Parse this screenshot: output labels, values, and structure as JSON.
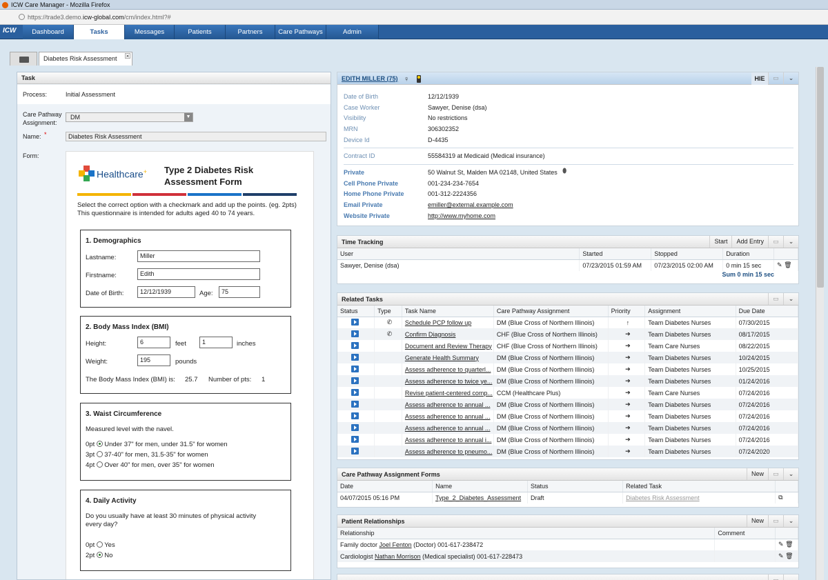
{
  "window": {
    "title": "ICW Care Manager - Mozilla Firefox",
    "url_prefix": "https://trade3.demo.",
    "url_host": "icw-global.com",
    "url_path": "/cm/index.html?#"
  },
  "nav": {
    "logo": "ICW",
    "tabs": [
      "Dashboard",
      "Tasks",
      "Messages",
      "Patients",
      "Partners",
      "Care Pathways",
      "Admin"
    ],
    "active": "Tasks"
  },
  "doc_tab": {
    "label": "Diabetes Risk Assessment",
    "close": "×"
  },
  "task": {
    "header": "Task",
    "process_label": "Process:",
    "process_value": "Initial Assessment",
    "cpa_label": "Care Pathway Assignment:",
    "cpa_value": "DM",
    "name_label": "Name:",
    "name_required": "*",
    "name_value": "Diabetes Risk Assessment",
    "form_label": "Form:"
  },
  "form": {
    "brand": "Healthcare",
    "brand_plus": "+",
    "title": "Type 2 Diabetes Risk Assessment Form",
    "intro": "Select the correct option with a checkmark and add up the points. (eg. 2pts) This questionnaire is intended for adults aged 40 to 74 years.",
    "demographics": {
      "title": "1. Demographics",
      "lastname_label": "Lastname:",
      "lastname": "Miller",
      "firstname_label": "Firstname:",
      "firstname": "Edith",
      "dob_label": "Date of Birth:",
      "dob": "12/12/1939",
      "age_label": "Age:",
      "age": "75"
    },
    "bmi": {
      "title": "2. Body Mass Index (BMI)",
      "height_label": "Height:",
      "height_feet": "6",
      "feet_label": "feet",
      "height_inches": "1",
      "inches_label": "inches",
      "weight_label": "Weight:",
      "weight": "195",
      "pounds_label": "pounds",
      "bmi_label": "The Body Mass Index (BMI) is:",
      "bmi_value": "25.7",
      "points_label": "Number of pts:",
      "points_value": "1"
    },
    "waist": {
      "title": "3. Waist Circumference",
      "desc": "Measured level with the navel.",
      "options": [
        {
          "pts": "0pt",
          "text": "Under 37\" for men, under 31.5\" for women",
          "checked": true
        },
        {
          "pts": "3pt",
          "text": "37-40\" for men, 31.5-35\" for women",
          "checked": false
        },
        {
          "pts": "4pt",
          "text": "Over 40\" for men, over 35\" for women",
          "checked": false
        }
      ]
    },
    "activity": {
      "title": "4. Daily Activity",
      "desc": "Do you usually have at least 30 minutes of physical activity every day?",
      "options": [
        {
          "pts": "0pt",
          "text": "Yes",
          "checked": false
        },
        {
          "pts": "2pt",
          "text": "No",
          "checked": true
        }
      ]
    }
  },
  "patient": {
    "name": "EDITH MILLER (75)",
    "hie": "HIE",
    "fields": [
      {
        "label": "Date of Birth",
        "value": "12/12/1939"
      },
      {
        "label": "Case Worker",
        "value": "Sawyer, Denise (dsa)"
      },
      {
        "label": "Visibility",
        "value": "No restrictions"
      },
      {
        "label": "MRN",
        "value": "306302352"
      },
      {
        "label": "Device Id",
        "value": "D-4435"
      }
    ],
    "contract_label": "Contract ID",
    "contract_value": "55584319 at Medicaid (Medical insurance)",
    "contact": [
      {
        "label": "Private",
        "value": "50 Walnut St, Malden MA 02148, United States"
      },
      {
        "label": "Cell Phone Private",
        "value": "001-234-234-7654"
      },
      {
        "label": "Home Phone Private",
        "value": "001-312-2224356"
      },
      {
        "label": "Email Private",
        "value": "emiller@external.example.com"
      },
      {
        "label": "Website Private",
        "value": "http://www.myhome.com"
      }
    ]
  },
  "time_tracking": {
    "title": "Time Tracking",
    "start": "Start",
    "add_entry": "Add Entry",
    "columns": [
      "User",
      "Started",
      "Stopped",
      "Duration"
    ],
    "rows": [
      {
        "user": "Sawyer, Denise (dsa)",
        "started": "07/23/2015 01:59 AM",
        "stopped": "07/23/2015 02:00 AM",
        "duration": "0 min 15 sec"
      }
    ],
    "sum": "Sum 0 min 15 sec"
  },
  "related_tasks": {
    "title": "Related Tasks",
    "columns": [
      "Status",
      "Type",
      "Task Name",
      "Care Pathway Assignment",
      "Priority",
      "Assignment",
      "Due Date"
    ],
    "rows": [
      {
        "type": "phone",
        "name": "Schedule PCP follow up",
        "cpa": "DM (Blue Cross of Northern Illinois)",
        "priority": "↑",
        "assignment": "Team Diabetes Nurses",
        "due": "07/30/2015"
      },
      {
        "type": "phone",
        "name": "Confirm Diagnosis",
        "cpa": "CHF (Blue Cross of Northern Illinois)",
        "priority": "➔",
        "assignment": "Team Diabetes Nurses",
        "due": "08/17/2015"
      },
      {
        "type": "",
        "name": "Document and Review Therapy",
        "cpa": "CHF (Blue Cross of Northern Illinois)",
        "priority": "➔",
        "assignment": "Team Care Nurses",
        "due": "08/22/2015"
      },
      {
        "type": "",
        "name": "Generate Health Summary",
        "cpa": "DM (Blue Cross of Northern Illinois)",
        "priority": "➔",
        "assignment": "Team Diabetes Nurses",
        "due": "10/24/2015"
      },
      {
        "type": "",
        "name": "Assess adherence to quarterl...",
        "cpa": "DM (Blue Cross of Northern Illinois)",
        "priority": "➔",
        "assignment": "Team Diabetes Nurses",
        "due": "10/25/2015"
      },
      {
        "type": "",
        "name": "Assess adherence to twice ye...",
        "cpa": "DM (Blue Cross of Northern Illinois)",
        "priority": "➔",
        "assignment": "Team Diabetes Nurses",
        "due": "01/24/2016"
      },
      {
        "type": "",
        "name": "Revise patient-centered comp...",
        "cpa": "CCM (Healthcare Plus)",
        "priority": "➔",
        "assignment": "Team Care Nurses",
        "due": "07/24/2016"
      },
      {
        "type": "",
        "name": "Assess adherence to annual ...",
        "cpa": "DM (Blue Cross of Northern Illinois)",
        "priority": "➔",
        "assignment": "Team Diabetes Nurses",
        "due": "07/24/2016"
      },
      {
        "type": "",
        "name": "Assess adherence to annual ...",
        "cpa": "DM (Blue Cross of Northern Illinois)",
        "priority": "➔",
        "assignment": "Team Diabetes Nurses",
        "due": "07/24/2016"
      },
      {
        "type": "",
        "name": "Assess adherence to annual ...",
        "cpa": "DM (Blue Cross of Northern Illinois)",
        "priority": "➔",
        "assignment": "Team Diabetes Nurses",
        "due": "07/24/2016"
      },
      {
        "type": "",
        "name": "Assess adherence to annual i...",
        "cpa": "DM (Blue Cross of Northern Illinois)",
        "priority": "➔",
        "assignment": "Team Diabetes Nurses",
        "due": "07/24/2016"
      },
      {
        "type": "",
        "name": "Assess adherence to pneumo...",
        "cpa": "DM (Blue Cross of Northern Illinois)",
        "priority": "➔",
        "assignment": "Team Diabetes Nurses",
        "due": "07/24/2020"
      }
    ]
  },
  "cpa_forms": {
    "title": "Care Pathway Assignment Forms",
    "new": "New",
    "columns": [
      "Date",
      "Name",
      "Status",
      "Related Task"
    ],
    "rows": [
      {
        "date": "04/07/2015 05:16 PM",
        "name": "Type_2_Diabetes_Assessment",
        "status": "Draft",
        "related": "Diabetes Risk Assessment"
      }
    ]
  },
  "relationships": {
    "title": "Patient Relationships",
    "new": "New",
    "columns": [
      "Relationship",
      "Comment"
    ],
    "rows": [
      {
        "role": "Family doctor",
        "name": "Joel Fenton",
        "detail": "(Doctor) 001-617-238472"
      },
      {
        "role": "Cardiologist",
        "name": "Nathan Morrison",
        "detail": "(Medical specialist) 001-617-228473"
      }
    ]
  },
  "colors": {
    "nav": "#2a5f9e",
    "accent": "#2b72c0",
    "link": "#4a7bb0"
  }
}
